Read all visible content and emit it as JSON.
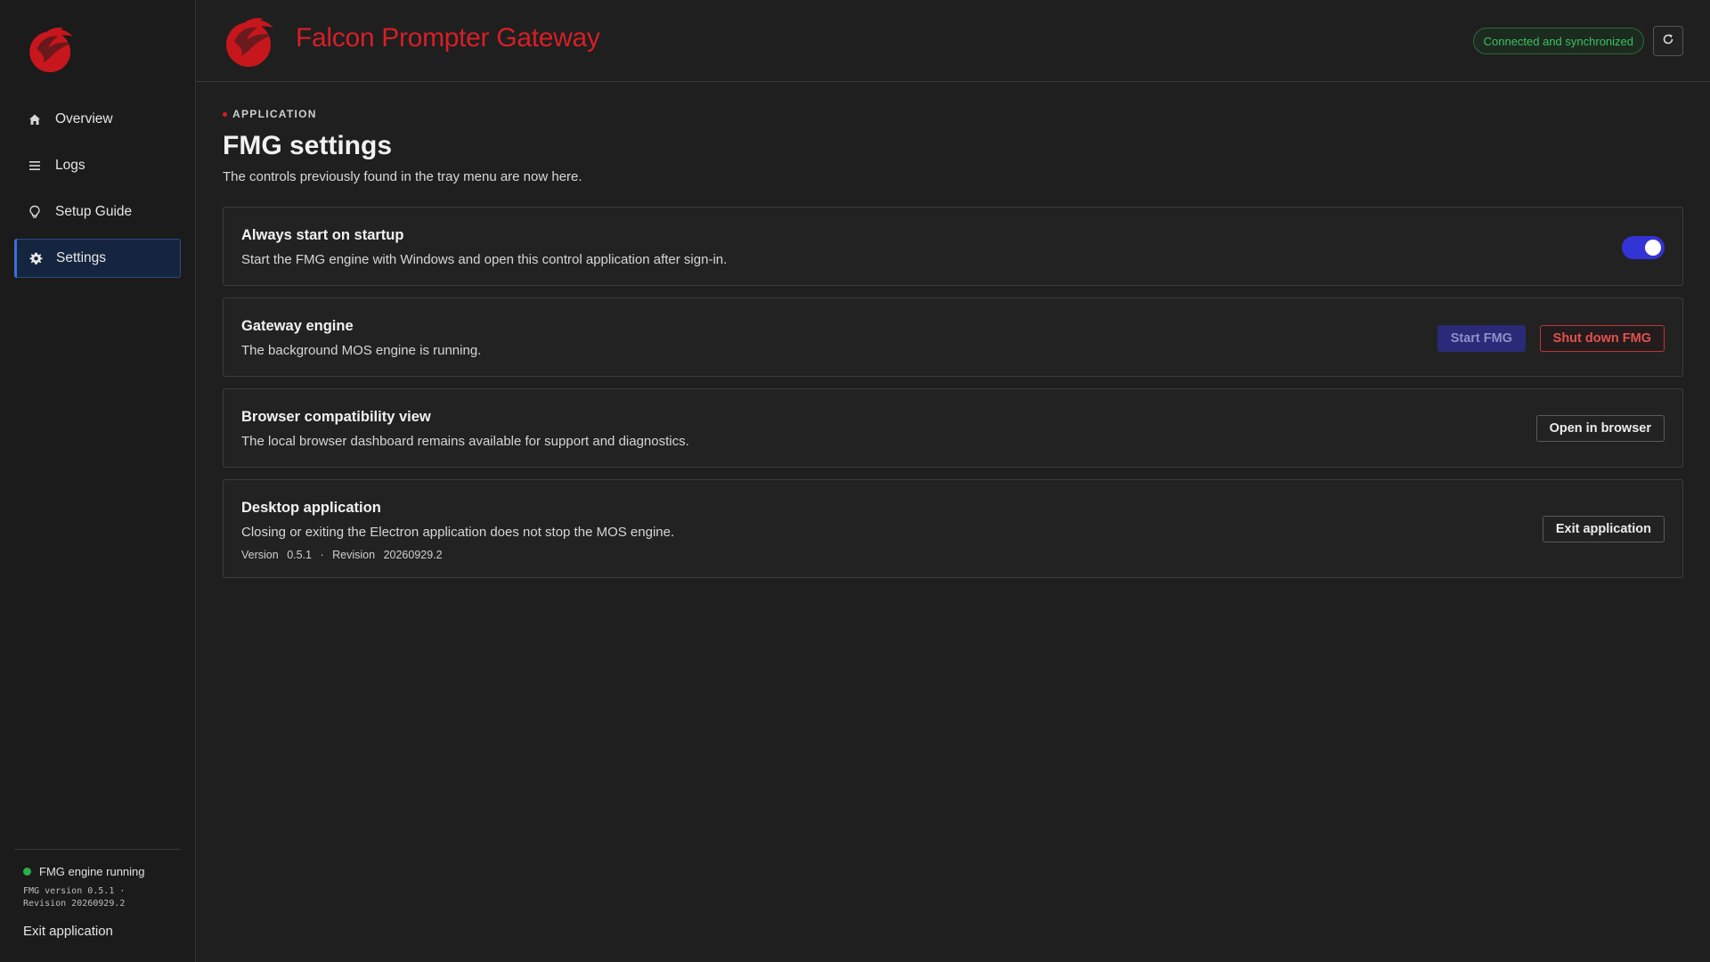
{
  "app": {
    "title": "Falcon Prompter Gateway",
    "brand_color": "#d61f26"
  },
  "header": {
    "status": "Connected and synchronized",
    "refresh_icon": "refresh-icon"
  },
  "sidebar": {
    "items": [
      {
        "label": "Overview",
        "icon": "home-icon"
      },
      {
        "label": "Logs",
        "icon": "list-icon"
      },
      {
        "label": "Setup Guide",
        "icon": "lightbulb-icon"
      },
      {
        "label": "Settings",
        "icon": "gear-icon",
        "active": true
      }
    ],
    "engine_status": "FMG engine running",
    "version_line": "FMG version 0.5.1 ·",
    "revision_line": "Revision 20260929.2",
    "exit_label": "Exit application"
  },
  "main": {
    "eyebrow": "APPLICATION",
    "title": "FMG settings",
    "subtitle": "The controls previously found in the tray menu are now here.",
    "cards": {
      "startup": {
        "title": "Always start on startup",
        "desc": "Start the FMG engine with Windows and open this control application after sign-in.",
        "toggle_on": true
      },
      "engine": {
        "title": "Gateway engine",
        "desc": "The background MOS engine is running.",
        "start_label": "Start FMG",
        "shutdown_label": "Shut down FMG"
      },
      "browser": {
        "title": "Browser compatibility view",
        "desc": "The local browser dashboard remains available for support and diagnostics.",
        "open_label": "Open in browser"
      },
      "desktop": {
        "title": "Desktop application",
        "desc": "Closing or exiting the Electron application does not stop the MOS engine.",
        "version_label": "Version",
        "version_value": "0.5.1",
        "separator": "·",
        "revision_label": "Revision",
        "revision_value": "20260929.2",
        "exit_label": "Exit application"
      }
    }
  }
}
